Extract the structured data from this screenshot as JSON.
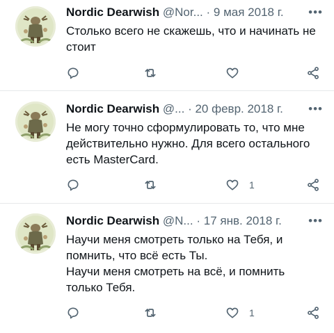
{
  "tweets": [
    {
      "name": "Nordic Dearwish",
      "handle": "@Nor...",
      "dot": "·",
      "date": "9 мая 2018 г.",
      "more": "•••",
      "text": "Столько всего не скажешь, что и начинать не стоит",
      "like_count": ""
    },
    {
      "name": "Nordic Dearwish",
      "handle": "@...",
      "dot": "·",
      "date": "20 февр. 2018 г.",
      "more": "•••",
      "text": "Не могу точно сформулировать то, что мне действительно нужно. Для всего остального есть MasterCard.",
      "like_count": "1"
    },
    {
      "name": "Nordic Dearwish",
      "handle": "@N...",
      "dot": "·",
      "date": "17 янв. 2018 г.",
      "more": "•••",
      "text": "Научи меня смотреть только на Тебя, и помнить, что всё есть Ты.\nНаучи меня смотреть на всё, и помнить только Тебя.",
      "like_count": "1"
    }
  ],
  "icons": {
    "reply": "reply-icon",
    "retweet": "retweet-icon",
    "like": "like-icon",
    "share": "share-icon"
  },
  "colors": {
    "text": "#0f1419",
    "muted": "#536471",
    "divider": "#e6e8ea"
  }
}
